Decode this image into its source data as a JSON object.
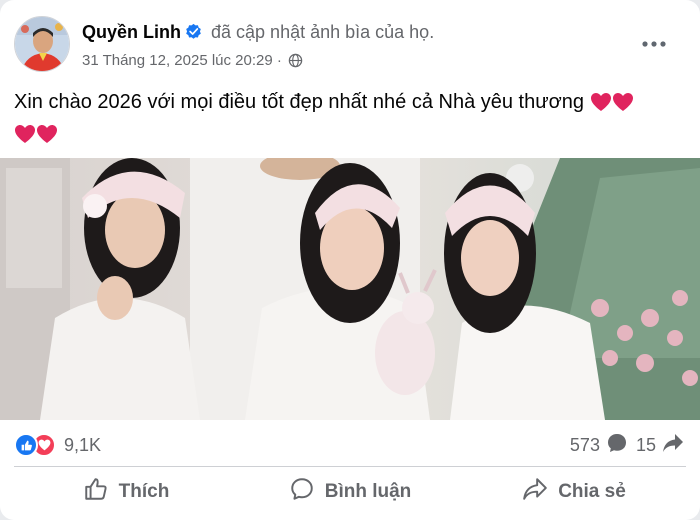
{
  "post": {
    "author": "Quyền Linh",
    "update_text": "đã cập nhật ảnh bìa của họ.",
    "timestamp": "31 Tháng 12, 2025 lúc 20:29",
    "text_line1": "Xin chào 2026 với mọi điều tốt đẹp nhất nhé cả Nhà yêu thương",
    "image_alt": "Ảnh bìa"
  },
  "icons": {
    "verified": "verified-badge-icon",
    "privacy": "globe-icon",
    "more": "more-options-icon",
    "like_reaction": "like-reaction-icon",
    "love_reaction": "love-reaction-icon",
    "comment": "comment-bubble-icon",
    "share": "share-arrow-icon"
  },
  "reactions": {
    "count": "9,1K"
  },
  "stats": {
    "comments": "573",
    "shares": "15"
  },
  "actions": {
    "like": "Thích",
    "comment": "Bình luận",
    "share": "Chia sẻ"
  },
  "colors": {
    "brand_blue": "#1877f2",
    "love_red": "#f33e58",
    "muted_text": "#65676b",
    "heart": "#e0245e"
  }
}
